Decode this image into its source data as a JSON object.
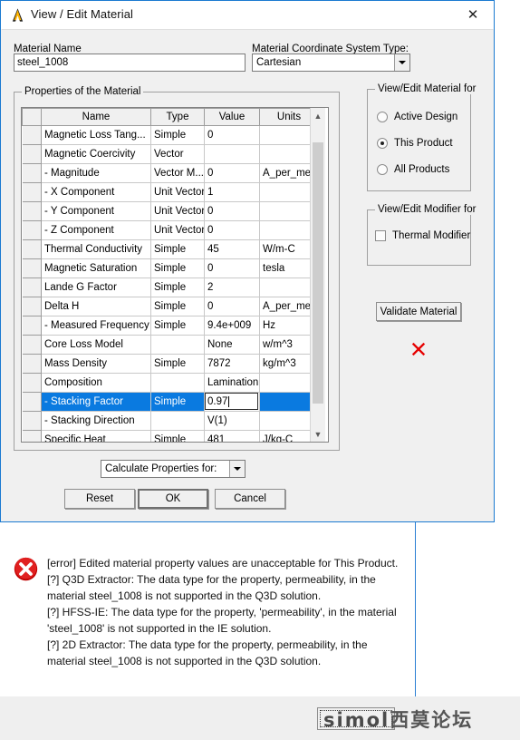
{
  "window": {
    "title": "View / Edit Material",
    "icon": "ansys-logo-icon",
    "close_label": "✕"
  },
  "fields": {
    "material_name_label": "Material Name",
    "material_name_value": "steel_1008",
    "coord_system_label": "Material Coordinate System Type:",
    "coord_system_value": "Cartesian"
  },
  "properties_group": {
    "title": "Properties of the Material",
    "columns": [
      "Name",
      "Type",
      "Value",
      "Units"
    ],
    "rows": [
      {
        "name": "Magnetic Loss Tang...",
        "type": "Simple",
        "value": "0",
        "units": ""
      },
      {
        "name": "Magnetic Coercivity",
        "type": "Vector",
        "value": "",
        "units": ""
      },
      {
        "name": "-  Magnitude",
        "type": "Vector M...",
        "value": "0",
        "units": "A_per_me..."
      },
      {
        "name": "-  X Component",
        "type": "Unit Vector",
        "value": "1",
        "units": ""
      },
      {
        "name": "-  Y Component",
        "type": "Unit Vector",
        "value": "0",
        "units": ""
      },
      {
        "name": "-  Z Component",
        "type": "Unit Vector",
        "value": "0",
        "units": ""
      },
      {
        "name": "Thermal Conductivity",
        "type": "Simple",
        "value": "45",
        "units": "W/m-C"
      },
      {
        "name": "Magnetic Saturation",
        "type": "Simple",
        "value": "0",
        "units": "tesla"
      },
      {
        "name": "Lande G Factor",
        "type": "Simple",
        "value": "2",
        "units": ""
      },
      {
        "name": "Delta H",
        "type": "Simple",
        "value": "0",
        "units": "A_per_me..."
      },
      {
        "name": "-  Measured Frequency",
        "type": "Simple",
        "value": "9.4e+009",
        "units": "Hz"
      },
      {
        "name": "Core Loss Model",
        "type": "",
        "value": "None",
        "units": "w/m^3"
      },
      {
        "name": "Mass Density",
        "type": "Simple",
        "value": "7872",
        "units": "kg/m^3"
      },
      {
        "name": "Composition",
        "type": "",
        "value": "Lamination",
        "units": ""
      },
      {
        "name": "- Stacking Factor",
        "type": "Simple",
        "value": "0.97",
        "units": "",
        "selected": true,
        "editing": true
      },
      {
        "name": "- Stacking Direction",
        "type": "",
        "value": "V(1)",
        "units": ""
      },
      {
        "name": "Specific Heat",
        "type": "Simple",
        "value": "481",
        "units": "J/kg-C"
      }
    ]
  },
  "view_edit_material_for": {
    "title": "View/Edit Material for",
    "options": [
      {
        "label": "Active Design",
        "selected": false
      },
      {
        "label": "This Product",
        "selected": true
      },
      {
        "label": "All Products",
        "selected": false
      }
    ]
  },
  "view_edit_modifier_for": {
    "title": "View/Edit Modifier for",
    "checkbox_label": "Thermal Modifier",
    "checked": false
  },
  "validate": {
    "button_label": "Validate Material",
    "status_icon": "red-x-icon",
    "status_color": "#e60000"
  },
  "calculate": {
    "combo_value": "Calculate Properties for:"
  },
  "dialog_buttons": {
    "reset": "Reset",
    "ok": "OK",
    "cancel": "Cancel"
  },
  "error_panel": {
    "icon": "error-circle-icon",
    "lines": [
      "[error] Edited material property values are unacceptable for This Product.",
      "[?] Q3D Extractor: The data type for the  property, permeability, in the material steel_1008 is not supported in the Q3D solution.",
      "[?] HFSS-IE: The data type for the  property, 'permeability', in the material 'steel_1008' is not supported in the IE solution.",
      "[?] 2D Extractor: The data type for the  property, permeability, in the material steel_1008 is not supported in the Q3D solution."
    ]
  },
  "watermark": {
    "latin": "simol",
    "chinese": "西莫论坛"
  }
}
